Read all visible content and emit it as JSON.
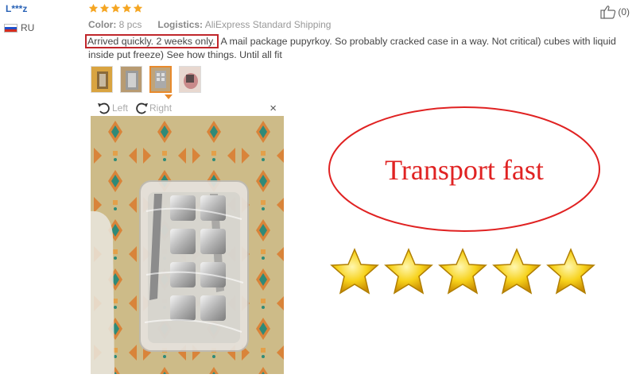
{
  "reviewer": {
    "name": "L***z",
    "country": "RU"
  },
  "rating": {
    "stars": 5
  },
  "meta": {
    "color_label": "Color:",
    "color_value": "8 pcs",
    "logistics_label": "Logistics:",
    "logistics_value": "AliExpress Standard Shipping"
  },
  "helpful": {
    "count": "(0)"
  },
  "review": {
    "highlight": "Arrived quickly. 2 weeks only.",
    "rest": " A mail package pupyrkoy. So probably cracked case in a way. Not critical) cubes with liquid inside put freeze) See how things. Until all fit"
  },
  "thumbnails": {
    "count": 4,
    "active_index": 2
  },
  "viewer": {
    "rotate_left": "Left",
    "rotate_right": "Right",
    "close": "×"
  },
  "overlay": {
    "text": "Transport fast",
    "star_count": 5
  },
  "colors": {
    "link": "#2962b6",
    "star": "#f5a623",
    "highlight": "#c0262b",
    "accent": "#e88a2c",
    "overlay_text": "#e02222"
  }
}
